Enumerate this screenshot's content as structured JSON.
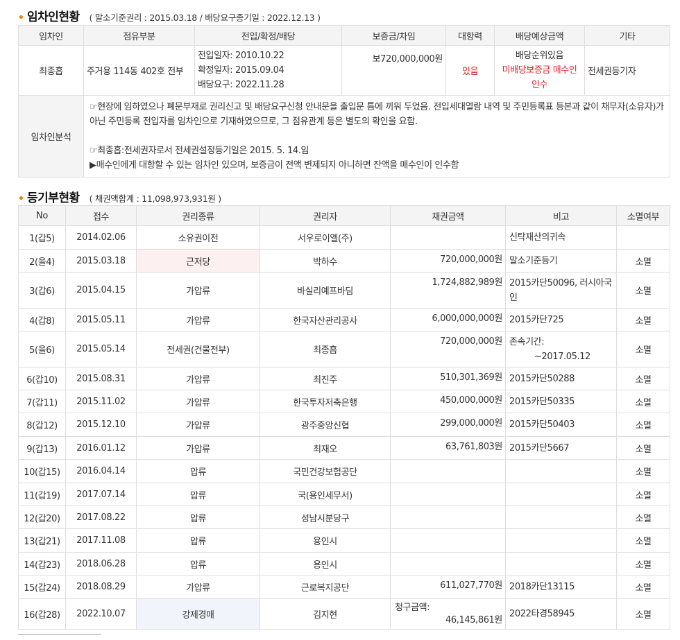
{
  "tenant": {
    "title": "임차인현황",
    "note": "( 말소기준권리 : 2015.03.18 / 배당요구종기일 : 2022.12.13 )",
    "headers": [
      "임차인",
      "점유부분",
      "전입/확정/배당",
      "보증금/차임",
      "대항력",
      "배당예상금액",
      "기타"
    ],
    "row": {
      "name": "최종흡",
      "part": "주거용 114동 402호 전부",
      "dates": [
        "전입일자: 2010.10.22",
        "확정일자: 2015.09.04",
        "배당요구: 2022.11.28"
      ],
      "deposit": "보720,000,000원",
      "opposition": "있음",
      "expected1": "배당순위있음",
      "expected2": "미배당보증금 매수인",
      "expected3": "인수",
      "etc": "전세권등기자"
    },
    "analysis_label": "임차인분석",
    "analysis": {
      "line1": "☞현장에 임하였으나 폐문부재로 권리신고 및 배당요구신청 안내문을 출입문 틈에 끼워 두었음. 전입세대열람 내역 및 주민등록표 등본과 같이 채무자(소유자)가 아닌 주민등록 전입자를 임차인으로 기재하였으므로, 그 점유관계 등은 별도의 확인을 요함.",
      "line2": "☞최종흡:전세권자로서 전세권설정등기일은 2015. 5. 14.임",
      "line3": "▶매수인에게 대항할 수 있는 임차인 있으며, 보증금이 전액 변제되지 아니하면 잔액을 매수인이 인수함"
    }
  },
  "register": {
    "title": "등기부현황",
    "note": "( 채권액합계 : 11,098,973,931원 )",
    "headers": [
      "No",
      "접수",
      "권리종류",
      "권리자",
      "채권금액",
      "비고",
      "소멸여부"
    ],
    "rows": [
      {
        "no": "1(갑5)",
        "date": "2014.02.06",
        "type": "소유권이전",
        "holder": "서우로이엘(주)",
        "amount": "",
        "note": "신탁재산의귀속",
        "status": ""
      },
      {
        "no": "2(을4)",
        "date": "2015.03.18",
        "type": "근저당",
        "holder": "박하수",
        "amount": "720,000,000원",
        "note": "말소기준등기",
        "status": "소멸"
      },
      {
        "no": "3(갑6)",
        "date": "2015.04.15",
        "type": "가압류",
        "holder": "바실리예프바딤",
        "amount": "1,724,882,989원",
        "note": "2015카단50096, 러시아국인",
        "status": "소멸"
      },
      {
        "no": "4(갑8)",
        "date": "2015.05.11",
        "type": "가압류",
        "holder": "한국자산관리공사",
        "amount": "6,000,000,000원",
        "note": "2015카단725",
        "status": "소멸"
      },
      {
        "no": "5(을6)",
        "date": "2015.05.14",
        "type": "전세권(건물전부)",
        "holder": "최종흡",
        "amount": "720,000,000원",
        "note": "존속기간:",
        "note2": "~2017.05.12",
        "status": "소멸"
      },
      {
        "no": "6(갑10)",
        "date": "2015.08.31",
        "type": "가압류",
        "holder": "최진주",
        "amount": "510,301,369원",
        "note": "2015카단50288",
        "status": "소멸"
      },
      {
        "no": "7(갑11)",
        "date": "2015.11.02",
        "type": "가압류",
        "holder": "한국투자저축은행",
        "amount": "450,000,000원",
        "note": "2015카단50335",
        "status": "소멸"
      },
      {
        "no": "8(갑12)",
        "date": "2015.12.10",
        "type": "가압류",
        "holder": "광주중앙신협",
        "amount": "299,000,000원",
        "note": "2015카단50403",
        "status": "소멸"
      },
      {
        "no": "9(갑13)",
        "date": "2016.01.12",
        "type": "가압류",
        "holder": "최재오",
        "amount": "63,761,803원",
        "note": "2015카단5667",
        "status": "소멸"
      },
      {
        "no": "10(갑15)",
        "date": "2016.04.14",
        "type": "압류",
        "holder": "국민건강보험공단",
        "amount": "",
        "note": "",
        "status": "소멸"
      },
      {
        "no": "11(갑19)",
        "date": "2017.07.14",
        "type": "압류",
        "holder": "국(용인세무서)",
        "amount": "",
        "note": "",
        "status": "소멸"
      },
      {
        "no": "12(갑20)",
        "date": "2017.08.22",
        "type": "압류",
        "holder": "성남시분당구",
        "amount": "",
        "note": "",
        "status": "소멸"
      },
      {
        "no": "13(갑21)",
        "date": "2017.11.08",
        "type": "압류",
        "holder": "용인시",
        "amount": "",
        "note": "",
        "status": "소멸"
      },
      {
        "no": "14(갑23)",
        "date": "2018.06.28",
        "type": "압류",
        "holder": "용인시",
        "amount": "",
        "note": "",
        "status": "소멸"
      },
      {
        "no": "15(갑24)",
        "date": "2018.08.29",
        "type": "가압류",
        "holder": "근로복지공단",
        "amount": "611,027,770원",
        "note": "2018카단13115",
        "status": "소멸"
      },
      {
        "no": "16(갑28)",
        "date": "2022.10.07",
        "type": "강제경매",
        "holder": "김지현",
        "amount_label": "청구금액:",
        "amount": "46,145,861원",
        "note": "2022타경58945",
        "status": "소멸"
      }
    ]
  }
}
